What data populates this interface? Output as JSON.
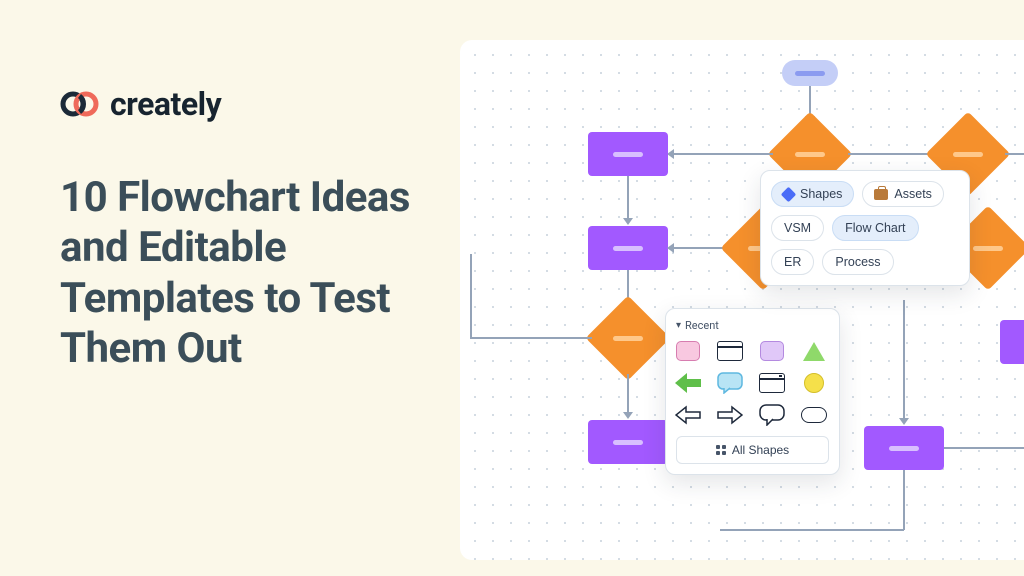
{
  "brand": {
    "name": "creately"
  },
  "headline": "10 Flowchart Ideas and Editable Templates to Test Them Out",
  "toolbar": {
    "tabs": {
      "shapes": "Shapes",
      "assets": "Assets"
    },
    "chips": {
      "vsm": "VSM",
      "flowchart": "Flow Chart",
      "er": "ER",
      "process": "Process"
    }
  },
  "palette": {
    "recent_label": "Recent",
    "all_shapes": "All Shapes"
  },
  "colors": {
    "process": "#a259ff",
    "decision": "#f5902c",
    "terminator": "#c4cef7"
  }
}
